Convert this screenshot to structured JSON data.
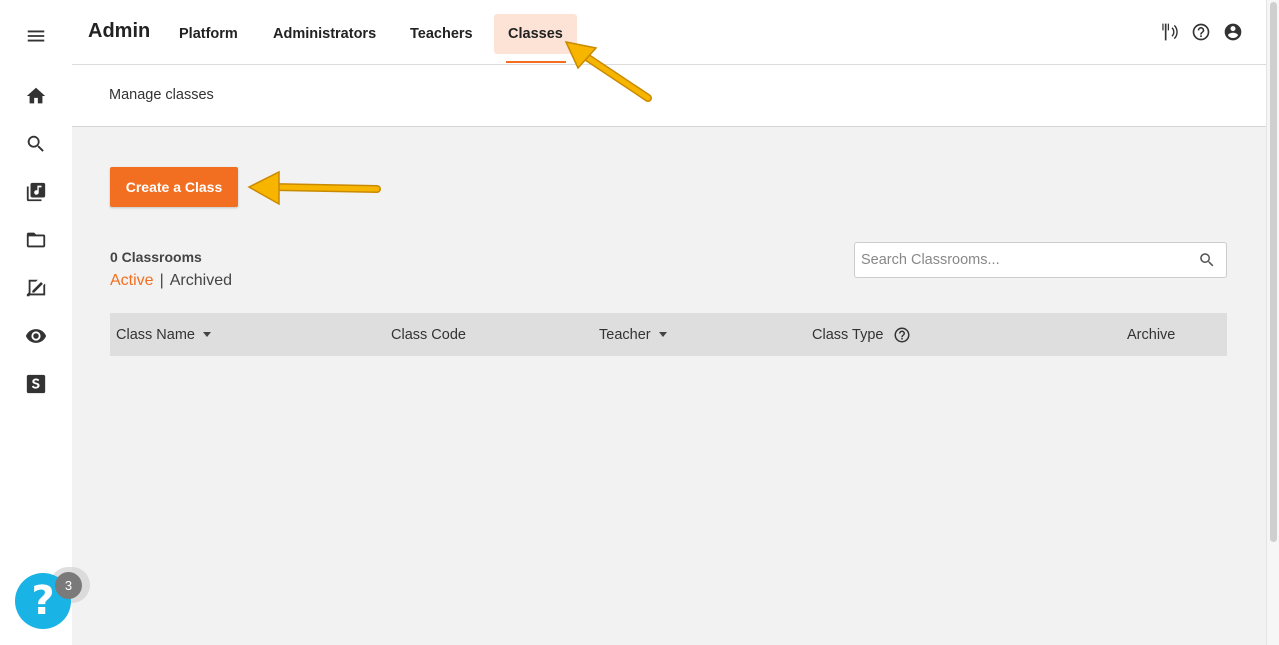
{
  "header": {
    "brand": "Admin",
    "tabs": [
      {
        "label": "Platform"
      },
      {
        "label": "Administrators"
      },
      {
        "label": "Teachers"
      },
      {
        "label": "Classes",
        "active": true
      }
    ],
    "icons": [
      "broadcast-icon",
      "help-circle-icon",
      "account-icon"
    ]
  },
  "rail": {
    "icons": [
      "menu-icon",
      "home-icon",
      "search-icon",
      "music-library-icon",
      "folder-icon",
      "assignment-icon",
      "eye-icon",
      "s-logo-icon"
    ]
  },
  "subheader": {
    "title": "Manage classes"
  },
  "main": {
    "create_button": "Create a Class",
    "count_label": "0 Classrooms",
    "filters": {
      "active": "Active",
      "separator": "|",
      "archived": "Archived"
    },
    "search": {
      "placeholder": "Search Classrooms..."
    },
    "table": {
      "columns": [
        {
          "label": "Class Name",
          "sortable": true
        },
        {
          "label": "Class Code"
        },
        {
          "label": "Teacher",
          "sortable": true
        },
        {
          "label": "Class Type",
          "help": true
        },
        {
          "label": "Archive"
        }
      ],
      "rows": []
    }
  },
  "help_widget": {
    "symbol": "?",
    "badge_count": "3"
  },
  "colors": {
    "accent": "#f26f21",
    "active_tab_bg": "#fde3d6",
    "help_widget": "#1ab3e6",
    "annotation_arrow": "#f7b500"
  }
}
